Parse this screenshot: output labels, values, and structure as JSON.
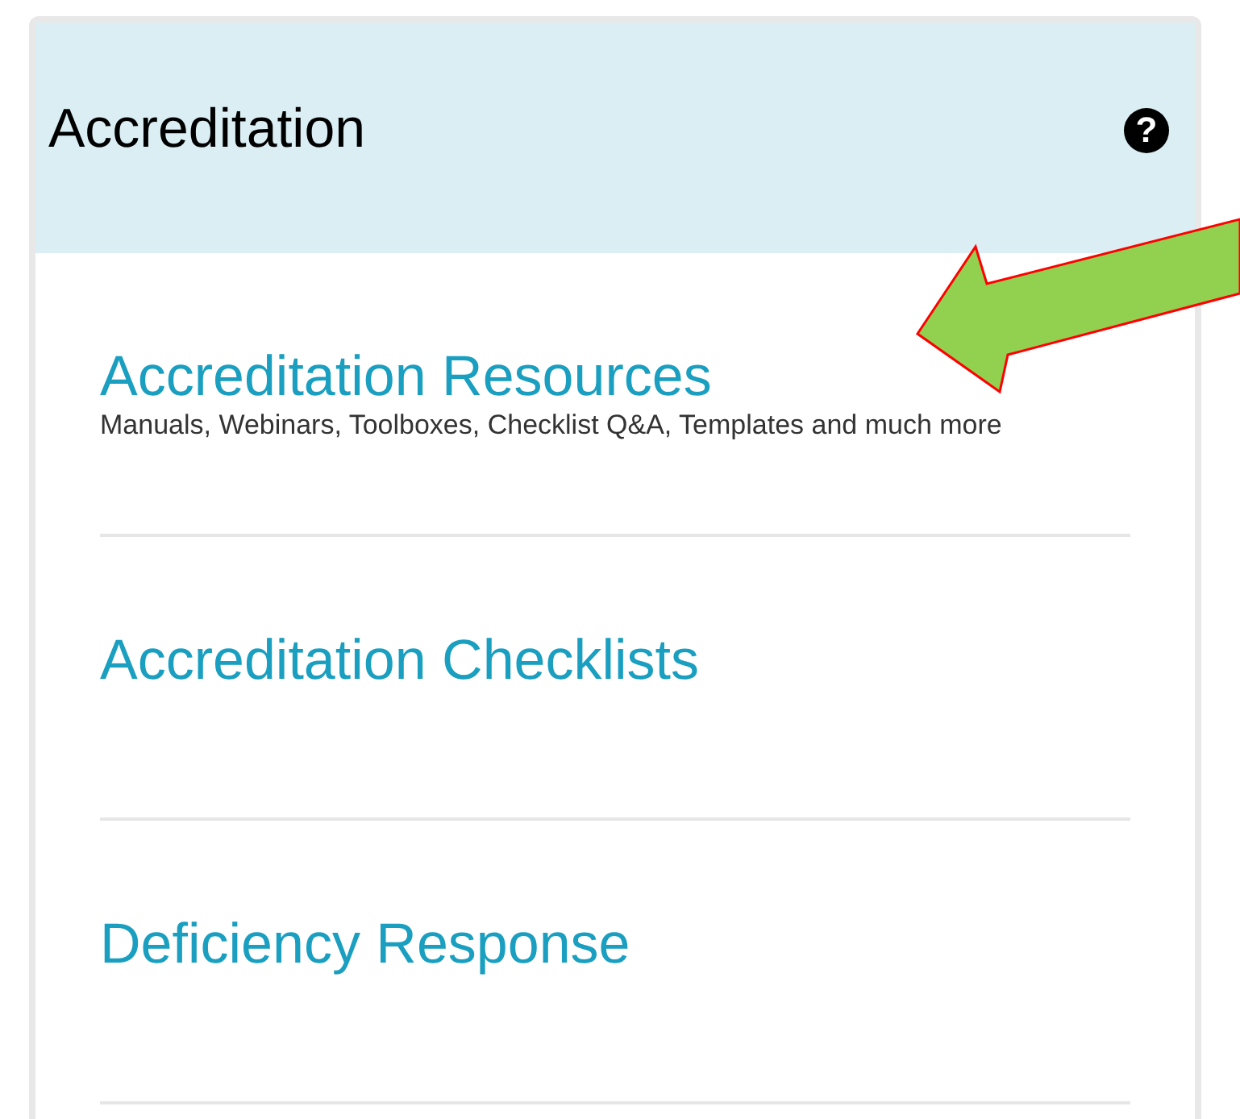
{
  "panel": {
    "title": "Accreditation",
    "help_icon": "?"
  },
  "items": [
    {
      "title": "Accreditation Resources",
      "description": "Manuals, Webinars, Toolboxes, Checklist Q&A, Templates and much more"
    },
    {
      "title": "Accreditation Checklists"
    },
    {
      "title": "Deficiency Response"
    }
  ]
}
